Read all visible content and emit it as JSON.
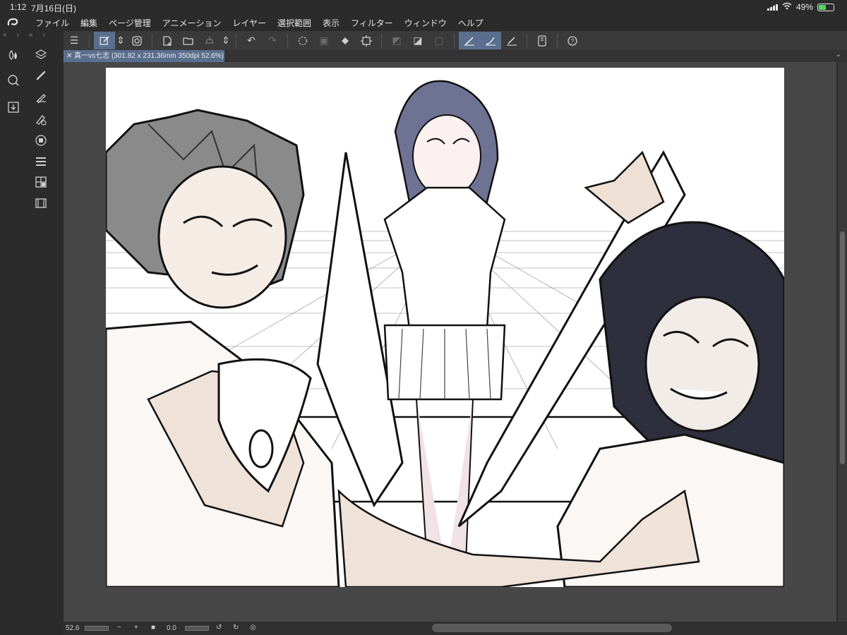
{
  "status": {
    "time": "1:12",
    "date": "7月16日(日)",
    "battery": "49%",
    "battery_level": 0.49
  },
  "menu": {
    "logo_icon": "clip-studio-logo-icon",
    "items": [
      "ファイル",
      "編集",
      "ページ管理",
      "アニメーション",
      "レイヤー",
      "選択範囲",
      "表示",
      "フィルター",
      "ウィンドウ",
      "ヘルプ"
    ]
  },
  "document": {
    "tab_title": "真一vs七志 (301.82 x 231.36mm 350dpi 52.6%)"
  },
  "bottom": {
    "zoom": "52.6",
    "angle": "0.0"
  },
  "colors": {
    "accent": "#5a6f8f",
    "background": "#2b2b2b",
    "workspace": "#474747",
    "canvas": "#ffffff"
  }
}
